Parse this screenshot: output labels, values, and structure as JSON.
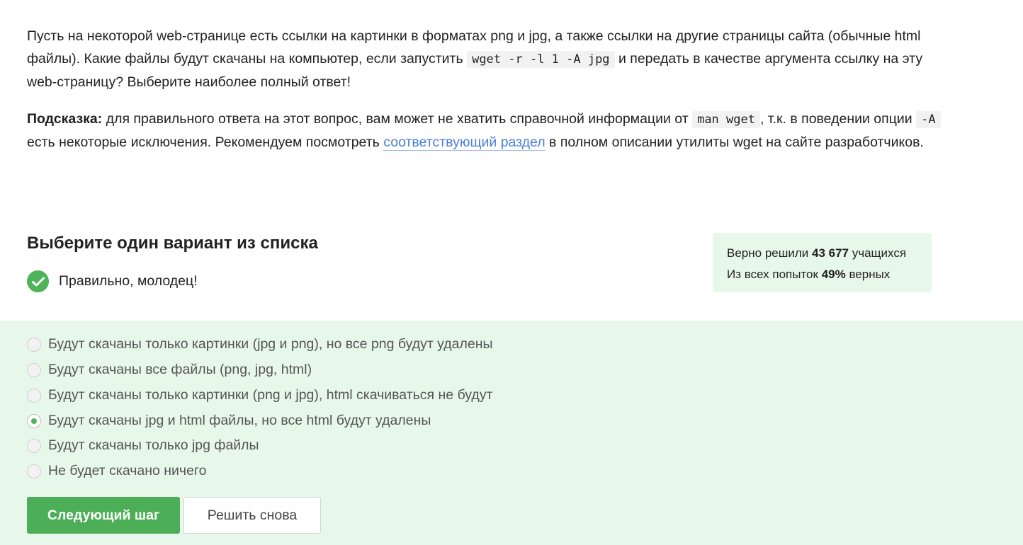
{
  "question": {
    "p1_before": "Пусть на некоторой web-странице есть ссылки на картинки в форматах png и jpg, а также ссылки на другие страницы сайта (обычные html файлы). Какие файлы будут скачаны на компьютер, если запустить ",
    "p1_code": "wget -r -l 1 -A jpg",
    "p1_after": " и передать в качестве аргумента ссылку на эту web-страницу? Выберите наиболее полный ответ!",
    "hint_label": "Подсказка:",
    "hint_part1": " для правильного ответа на этот вопрос, вам может не хватить справочной информации от ",
    "hint_code1": "man wget",
    "hint_part2": ", т.к. в поведении опции ",
    "hint_code2": "-A",
    "hint_part3": " есть некоторые исключения. Рекомендуем посмотреть ",
    "hint_link": "соответствующий раздел",
    "hint_part4": " в полном описании утилиты wget на сайте разработчиков."
  },
  "section_title": "Выберите один вариант из списка",
  "feedback": "Правильно, молодец!",
  "stats": {
    "solved_prefix": "Верно решили ",
    "solved_count": "43 677",
    "solved_suffix": " учащихся",
    "attempts_prefix": "Из всех попыток ",
    "attempts_percent": "49%",
    "attempts_suffix": " верных"
  },
  "options": [
    {
      "label": "Будут скачаны только картинки (jpg и png), но все png будут удалены",
      "selected": false
    },
    {
      "label": "Будут скачаны все файлы (png, jpg, html)",
      "selected": false
    },
    {
      "label": "Будут скачаны только картинки (png и jpg), html скачиваться не будут",
      "selected": false
    },
    {
      "label": "Будут скачаны jpg и html файлы, но все html будут удалены",
      "selected": true
    },
    {
      "label": "Будут скачаны только jpg файлы",
      "selected": false
    },
    {
      "label": "Не будет скачано ничего",
      "selected": false
    }
  ],
  "buttons": {
    "next": "Следующий шаг",
    "retry": "Решить снова"
  },
  "colors": {
    "accent_green": "#4cae56",
    "panel_bg": "#e7f7e9",
    "link": "#4a7fd6"
  }
}
